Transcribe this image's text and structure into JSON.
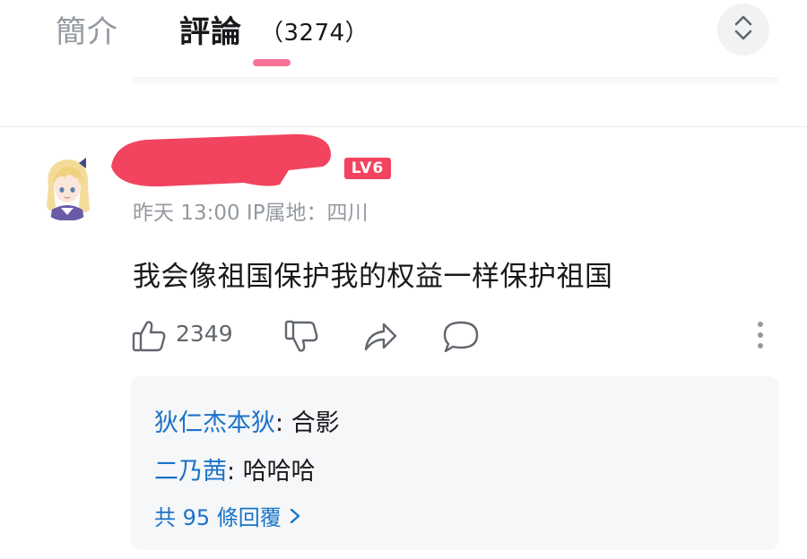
{
  "tabs": {
    "intro_label": "簡介",
    "comments_label": "評論",
    "comments_count": "（3274）",
    "active_color": "#fb7299"
  },
  "comment": {
    "level_badge": "LV6",
    "meta": "昨天 13:00 IP属地：四川",
    "text": "我会像祖国保护我的权益一样保护祖国",
    "like_count": "2349",
    "redaction_color": "#f2445f"
  },
  "replies": {
    "items": [
      {
        "author": "狄仁杰本狄",
        "sep": ": ",
        "text": "合影"
      },
      {
        "author": "二乃茜",
        "sep": ": ",
        "text": "哈哈哈"
      }
    ],
    "more_label": "共 95 條回覆",
    "link_color": "#1a73c9"
  },
  "icons": {
    "collapse": "chevron-up-down-icon",
    "like": "thumbs-up-icon",
    "dislike": "thumbs-down-icon",
    "share": "share-arrow-icon",
    "reply": "speech-bubble-icon",
    "more": "vertical-dots-icon"
  }
}
